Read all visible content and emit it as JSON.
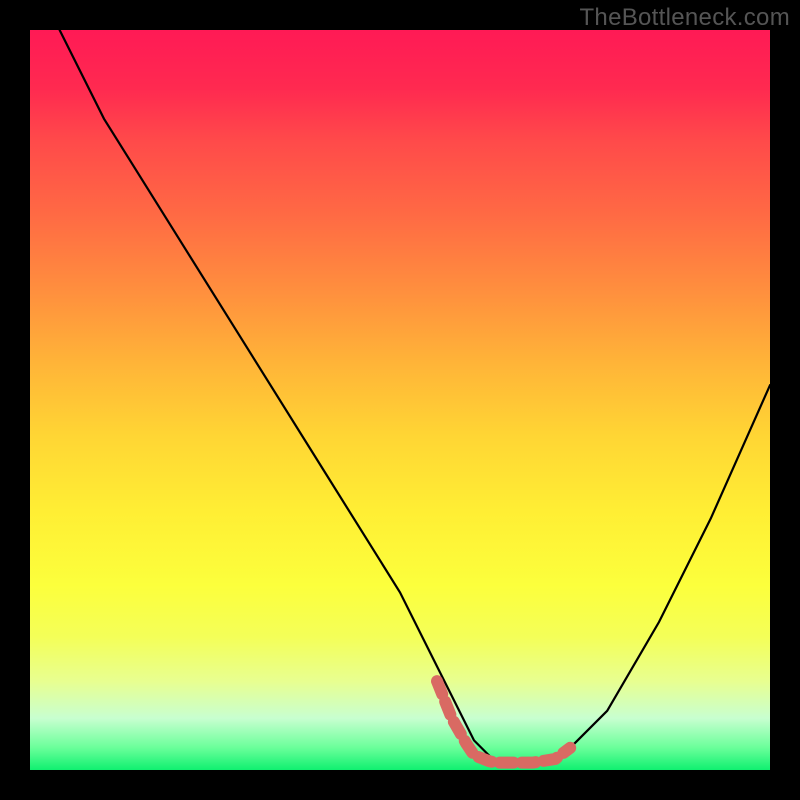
{
  "watermark": "TheBottleneck.com",
  "chart_data": {
    "type": "line",
    "title": "",
    "xlabel": "",
    "ylabel": "",
    "xlim": [
      0,
      100
    ],
    "ylim": [
      0,
      100
    ],
    "series": [
      {
        "name": "bottleneck-curve",
        "x": [
          4,
          10,
          20,
          30,
          40,
          50,
          55,
          58,
          60,
          63,
          66,
          68,
          72,
          78,
          85,
          92,
          100
        ],
        "values": [
          100,
          88,
          72,
          56,
          40,
          24,
          14,
          8,
          4,
          1,
          1,
          1,
          2,
          8,
          20,
          34,
          52
        ]
      }
    ],
    "markers": {
      "name": "optimal-zone",
      "color": "#d96a63",
      "points_x": [
        55,
        57,
        59,
        60,
        62,
        63,
        64,
        65,
        66,
        67,
        68,
        71,
        73
      ],
      "points_y": [
        12,
        7,
        3.5,
        2.0,
        1.2,
        1.0,
        1.0,
        1.0,
        1.0,
        1.0,
        1.0,
        1.5,
        3.0
      ]
    },
    "gradient_stops": [
      {
        "pos": 0.0,
        "color": "#ff1a55"
      },
      {
        "pos": 0.5,
        "color": "#ffd634"
      },
      {
        "pos": 0.85,
        "color": "#f4ff58"
      },
      {
        "pos": 1.0,
        "color": "#10f070"
      }
    ]
  }
}
